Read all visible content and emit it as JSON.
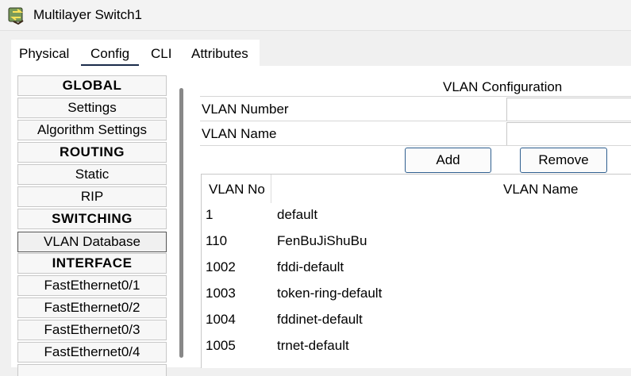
{
  "window": {
    "title": "Multilayer Switch1",
    "icon": "switch-icon"
  },
  "tabs": [
    {
      "label": "Physical"
    },
    {
      "label": "Config",
      "active": true
    },
    {
      "label": "CLI"
    },
    {
      "label": "Attributes"
    }
  ],
  "nav": {
    "items": [
      {
        "label": "GLOBAL",
        "type": "header"
      },
      {
        "label": "Settings"
      },
      {
        "label": "Algorithm Settings"
      },
      {
        "label": "ROUTING",
        "type": "header"
      },
      {
        "label": "Static"
      },
      {
        "label": "RIP"
      },
      {
        "label": "SWITCHING",
        "type": "header"
      },
      {
        "label": "VLAN Database",
        "selected": true
      },
      {
        "label": "INTERFACE",
        "type": "header"
      },
      {
        "label": "FastEthernet0/1"
      },
      {
        "label": "FastEthernet0/2"
      },
      {
        "label": "FastEthernet0/3"
      },
      {
        "label": "FastEthernet0/4"
      }
    ]
  },
  "vlan_config": {
    "title": "VLAN Configuration",
    "number_label": "VLAN Number",
    "number_value": "",
    "name_label": "VLAN Name",
    "name_value": "",
    "add_label": "Add",
    "remove_label": "Remove"
  },
  "vlan_table": {
    "columns": [
      "VLAN No",
      "VLAN Name"
    ],
    "rows": [
      {
        "no": "1",
        "name": "default"
      },
      {
        "no": "110",
        "name": "FenBuJiShuBu"
      },
      {
        "no": "1002",
        "name": "fddi-default"
      },
      {
        "no": "1003",
        "name": "token-ring-default"
      },
      {
        "no": "1004",
        "name": "fddinet-default"
      },
      {
        "no": "1005",
        "name": "trnet-default"
      }
    ]
  }
}
